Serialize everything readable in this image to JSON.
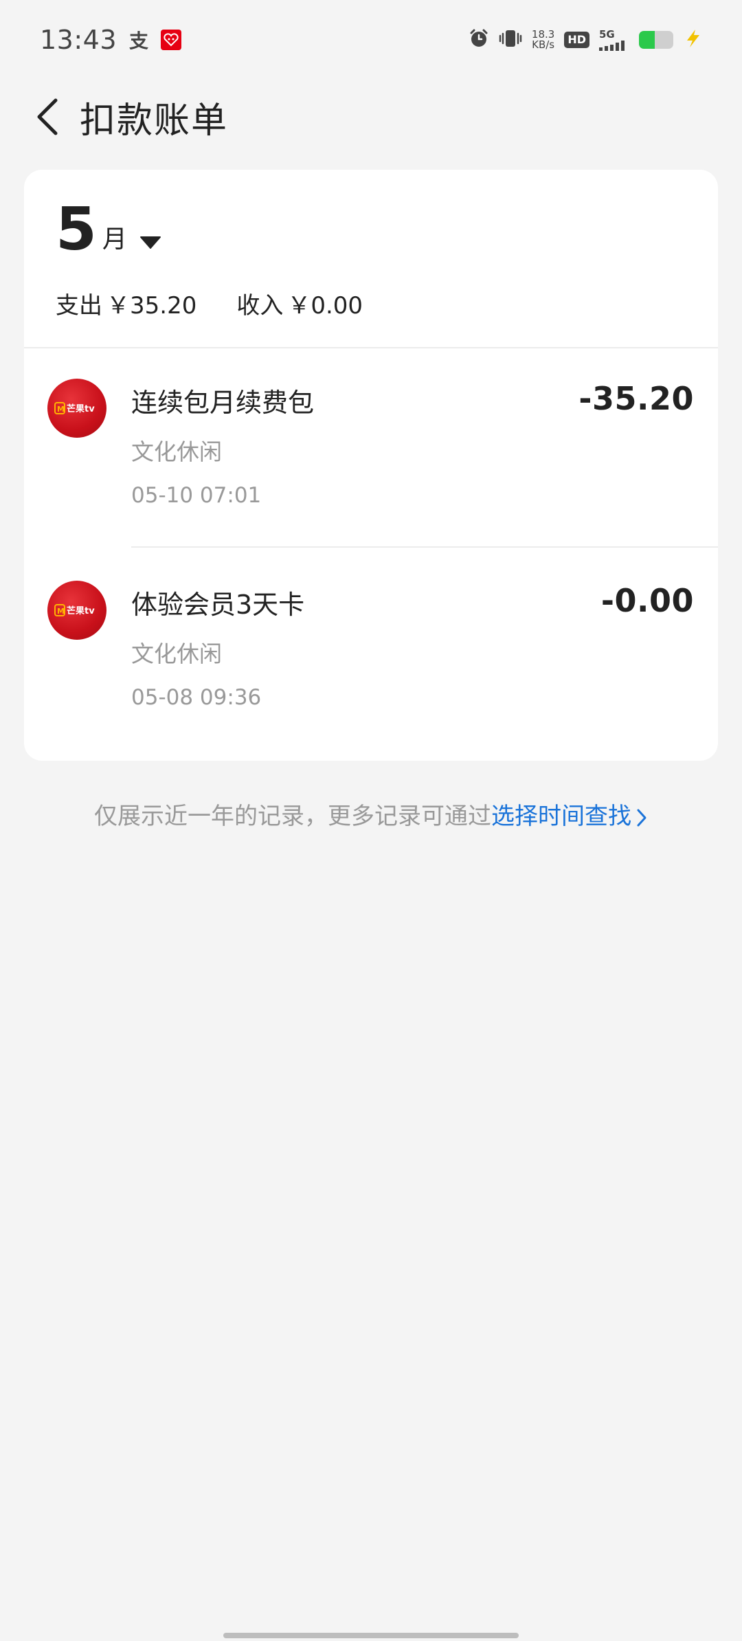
{
  "status_bar": {
    "time": "13:43",
    "alipay_glyph": "支",
    "speed_value": "18.3",
    "speed_unit": "KB/s",
    "hd_label": "HD",
    "network_label": "5G",
    "battery_level": 0.45,
    "colors": {
      "battery_fill": "#2bc94b",
      "charging_bolt": "#f2c200",
      "app_icon": "#e60012"
    }
  },
  "header": {
    "title": "扣款账单"
  },
  "summary": {
    "month_number": "5",
    "month_unit": "月",
    "expense_label": "支出",
    "expense_value": "￥35.20",
    "income_label": "收入",
    "income_value": "￥0.00"
  },
  "transactions": [
    {
      "title": "连续包月续费包",
      "category": "文化休闲",
      "time": "05-10 07:01",
      "amount": "-35.20",
      "logo_text": "芒果tv",
      "logo_icon": "mango-tv-logo"
    },
    {
      "title": "体验会员3天卡",
      "category": "文化休闲",
      "time": "05-08 09:36",
      "amount": "-0.00",
      "logo_text": "芒果tv",
      "logo_icon": "mango-tv-logo"
    }
  ],
  "footer": {
    "note": "仅展示近一年的记录，更多记录可通过",
    "link": "选择时间查找",
    "link_color": "#1a73d9"
  }
}
